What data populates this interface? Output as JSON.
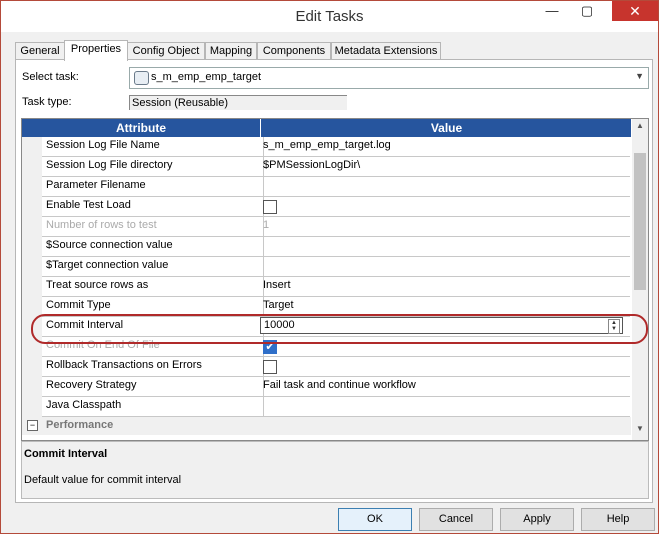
{
  "window": {
    "title": "Edit Tasks",
    "minimize": "—",
    "maximize": "▢",
    "close": "✕"
  },
  "tabs": [
    "General",
    "Properties",
    "Config Object",
    "Mapping",
    "Components",
    "Metadata Extensions"
  ],
  "active_tab": "Properties",
  "select_task": {
    "label": "Select task:",
    "value": "s_m_emp_emp_target"
  },
  "task_type": {
    "label": "Task type:",
    "value": "Session (Reusable)"
  },
  "grid": {
    "headers": {
      "attribute": "Attribute",
      "value": "Value"
    },
    "rows": [
      {
        "attr": "Session Log File Name",
        "value": "s_m_emp_emp_target.log"
      },
      {
        "attr": "Session Log File directory",
        "value": "$PMSessionLogDir\\"
      },
      {
        "attr": "Parameter Filename",
        "value": ""
      },
      {
        "attr": "Enable Test Load",
        "value": "",
        "checkbox": false
      },
      {
        "attr": "Number of rows to test",
        "value": "1",
        "disabled": true
      },
      {
        "attr": "$Source connection value",
        "value": ""
      },
      {
        "attr": "$Target connection value",
        "value": ""
      },
      {
        "attr": "Treat source rows as",
        "value": "Insert"
      },
      {
        "attr": "Commit Type",
        "value": "Target"
      },
      {
        "attr": "Commit Interval",
        "value": "10000",
        "editing": true
      },
      {
        "attr": "Commit On End Of File",
        "value": "",
        "checkbox": true,
        "disabled": true
      },
      {
        "attr": "Rollback Transactions on Errors",
        "value": "",
        "checkbox": false
      },
      {
        "attr": "Recovery Strategy",
        "value": "Fail task and continue workflow"
      },
      {
        "attr": "Java Classpath",
        "value": ""
      }
    ],
    "section": {
      "label": "Performance",
      "toggle": "−"
    }
  },
  "description": {
    "title": "Commit Interval",
    "text": "Default value for commit interval"
  },
  "buttons": {
    "ok": "OK",
    "cancel": "Cancel",
    "apply": "Apply",
    "help": "Help"
  },
  "colors": {
    "header_bg": "#26559e",
    "highlight_ring": "#b02a2a",
    "close_button": "#c7342d"
  },
  "icons": {
    "task_icon": "session-task-icon",
    "dropdown": "chevron-down-icon"
  }
}
